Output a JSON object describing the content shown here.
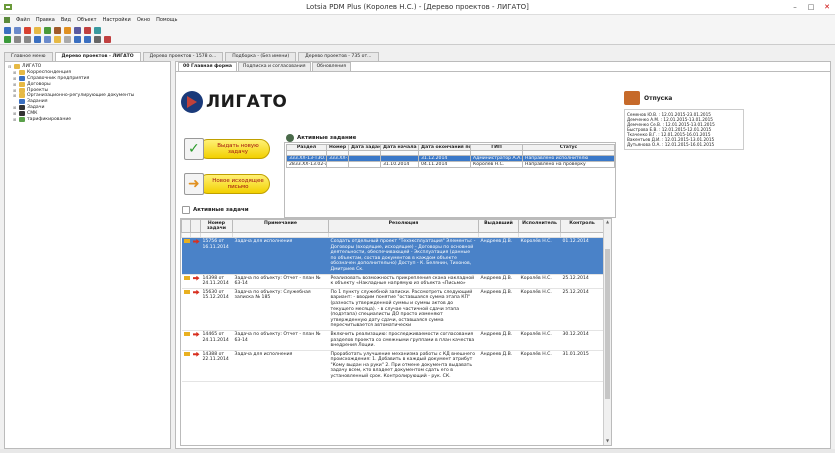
{
  "window": {
    "title": "Lotsia PDM Plus (Королев Н.С.) - [Дерево проектов - ЛИГАТО]",
    "minimize": "–",
    "maximize": "□",
    "close": "✕",
    "restore_mini": "_ □"
  },
  "menu": [
    "Файл",
    "Правка",
    "Вид",
    "Объект",
    "Настройки",
    "Окно",
    "Помощь"
  ],
  "window_tabs": [
    {
      "label": "Главное меню",
      "active": false
    },
    {
      "label": "Дерево проектов - ЛИГАТО",
      "active": true
    },
    {
      "label": "Дерево проектов - 1578 о...",
      "active": false
    },
    {
      "label": "Подборка - (Без имени)",
      "active": false
    },
    {
      "label": "Дерево проектов - 735 от...",
      "active": false
    }
  ],
  "tree": [
    {
      "label": "ЛИГАТО",
      "icon": "folder",
      "indent": 0,
      "exp": "⊟"
    },
    {
      "label": "Корреспонденция",
      "icon": "folder",
      "indent": 1,
      "exp": "⊞"
    },
    {
      "label": "Справочник предприятия",
      "icon": "blue",
      "indent": 1,
      "exp": "⊞"
    },
    {
      "label": "Договоры",
      "icon": "folder",
      "indent": 1,
      "exp": "⊞"
    },
    {
      "label": "Проекты",
      "icon": "folder",
      "indent": 1,
      "exp": "⊞"
    },
    {
      "label": "Организационно-регулирующие документы",
      "icon": "folder",
      "indent": 1,
      "exp": "⊞"
    },
    {
      "label": "Задания",
      "icon": "blue",
      "indent": 1,
      "exp": ""
    },
    {
      "label": "Задачи",
      "icon": "dark",
      "indent": 1,
      "exp": "⊞"
    },
    {
      "label": "СМК",
      "icon": "dark",
      "indent": 1,
      "exp": "⊞"
    },
    {
      "label": "тарификирование",
      "icon": "green",
      "indent": 1,
      "exp": "⊞"
    }
  ],
  "inner_tabs": [
    {
      "label": "00 Главная форма",
      "active": true
    },
    {
      "label": "Подписка и согласования",
      "active": false
    },
    {
      "label": "Обновления",
      "active": false
    }
  ],
  "logo": {
    "text": "ЛИГАТО"
  },
  "buttons": {
    "new_task": "Выдать новую задачу",
    "new_letter": "Новое исходящее письмо"
  },
  "active_assignment": {
    "heading": "Активные задание",
    "columns": [
      "Раздел",
      "Номер",
      "Дата задания",
      "Дата начала работ",
      "Дата окончания по заданию",
      "ГИП",
      "Статус"
    ],
    "rows": [
      {
        "cells": [
          "333.ХХ-13-Т3О...",
          "333.ХХ-13-Т3О_Изм.1",
          "",
          "",
          "31.12.2014",
          "Администратор А.А.",
          "Направлено исполнителю"
        ],
        "selected": true
      },
      {
        "cells": [
          "2833.ХХ-13.02-ЛГ2787 от 28.10.2014",
          "",
          "",
          "31.10.2014",
          "04.11.2014",
          "Королёв Н.С.",
          "Направлено на проверку"
        ],
        "selected": false
      }
    ]
  },
  "active_tasks": {
    "heading": "Активные задачи",
    "columns": [
      "",
      "",
      "Номер задачи",
      "Примечание",
      "Резолюция",
      "Выдавший",
      "Исполнитель",
      "Контроль"
    ],
    "rows": [
      {
        "num": "15756 от 16.11.2014",
        "note": "Задача для исполнения",
        "res": "Создать отдельный проект \"Техэксплуатация\" Элементы: - Договоры (входящие, исходящие) - Договоры по основной деятельности, обеспечивающей - Эксплуатация (данные по объектам, состав документов в каждом объекте обозначен дополнительно) Доступ - К. Белянин, Тихонов, Дмитриев Ск.",
        "issuer": "Андреев Д.В.",
        "executor": "Королёв Н.С.",
        "control": "01.12.2014",
        "selected": true
      },
      {
        "num": "14398 от 24.11.2014",
        "note": "Задача по объекту: Отчет - план № 63-14",
        "res": "Реализовать возможность прикрепления скана накладной к объекту «Накладные напрямую из объекта «Письмо»",
        "issuer": "Андреев Д.В.",
        "executor": "Королёв Н.С.",
        "control": "25.12.2014",
        "selected": false
      },
      {
        "num": "15630 от 15.12.2014",
        "note": "Задача по объекту: Служебная записка № 185",
        "res": "По 1 пункту служебной записки. Рассмотреть следующий вариант: - вводим понятие \"оставшаяся сумма этапа КП\" (разность утвержденной суммы и суммы актов до текущего месяца). - в случае частичной сдачи этапа (подэтапа) специалисты ДО просто изменяют утвержденную дату сдачи, оставшаяся сумма пересчитывается автоматически",
        "issuer": "Андреев Д.В.",
        "executor": "Королёв Н.С.",
        "control": "25.12.2014",
        "selected": false
      },
      {
        "num": "14465 от 24.11.2014",
        "note": "Задача по объекту: Отчет - план № 63-14",
        "res": "Включить реализацию: проследживаемости согласования разделов проекта со смежными группами в план качества внедрения Лоции.",
        "issuer": "Андреев Д.В.",
        "executor": "Королёв Н.С.",
        "control": "30.12.2014",
        "selected": false
      },
      {
        "num": "14388 от 22.11.2014",
        "note": "Задача для исполнения",
        "res": "Проработать улучшение механизма работы с КД внешнего происхождения: 1. Добавить в каждый документ атрибут \"Кому выдан на руки\" 2. При отмене документа выдавать задачу всем, кто владеет документом сдать его в установленный срок. Контролирующий - рук. СК.",
        "issuer": "Андреев Д.В.",
        "executor": "Королёв Н.С.",
        "control": "31.01.2015",
        "selected": false
      }
    ]
  },
  "vacations": {
    "heading": "Отпуска",
    "items": [
      "Семенов Ю.В. : 12.01.2015-23.01.2015",
      "Демченко А.М. : 12.01.2015-13.01.2015",
      "Демченко Се.В. : 12.01.2015-13.01.2015",
      "Быстрова Е.В. : 12.01.2015-12.01.2015",
      "Ткаченко В.Г. : 12.01.2015-16.01.2015",
      "Вакентьев Д.И. : 12.01.2015-13.01.2015",
      "Дутьянова О.А. : 12.01.2015-16.01.2015"
    ]
  }
}
